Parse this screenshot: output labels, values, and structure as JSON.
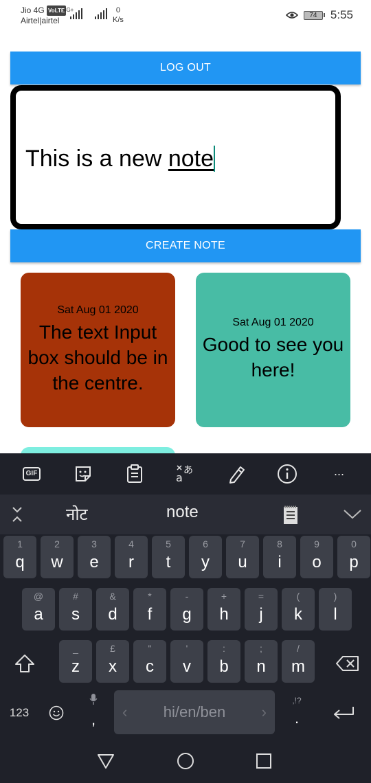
{
  "status_bar": {
    "carrier_line1": "Jio 4G",
    "volte_badge": "VoLTE",
    "carrier_line2": "Airtel|airtel",
    "network_type": "4G+",
    "speed_value": "0",
    "speed_unit": "K/s",
    "battery_level": "74",
    "time": "5:55"
  },
  "app": {
    "logout_label": "LOG OUT",
    "note_text_plain": "This is a new ",
    "note_text_word": "note",
    "create_label": "CREATE NOTE",
    "notes": [
      {
        "date": "Sat Aug 01 2020",
        "text": "The text Input box should be in the centre.",
        "color": "#a63308"
      },
      {
        "date": "Sat Aug 01 2020",
        "text": "Good to see you here!",
        "color": "#48bca5"
      }
    ],
    "partial_card_color": "#7eeee0"
  },
  "keyboard": {
    "toolbar_icons": [
      "gif-icon",
      "sticker-icon",
      "clipboard-icon",
      "translate-icon",
      "edit-icon",
      "info-icon",
      "more-icon"
    ],
    "gif_label": "GIF",
    "more_label": "···",
    "suggestions": [
      "नोट",
      "note"
    ],
    "row1": [
      {
        "hint": "1",
        "key": "q"
      },
      {
        "hint": "2",
        "key": "w"
      },
      {
        "hint": "3",
        "key": "e"
      },
      {
        "hint": "4",
        "key": "r"
      },
      {
        "hint": "5",
        "key": "t"
      },
      {
        "hint": "6",
        "key": "y"
      },
      {
        "hint": "7",
        "key": "u"
      },
      {
        "hint": "8",
        "key": "i"
      },
      {
        "hint": "9",
        "key": "o"
      },
      {
        "hint": "0",
        "key": "p"
      }
    ],
    "row2": [
      {
        "hint": "@",
        "key": "a"
      },
      {
        "hint": "#",
        "key": "s"
      },
      {
        "hint": "&",
        "key": "d"
      },
      {
        "hint": "*",
        "key": "f"
      },
      {
        "hint": "-",
        "key": "g"
      },
      {
        "hint": "+",
        "key": "h"
      },
      {
        "hint": "=",
        "key": "j"
      },
      {
        "hint": "(",
        "key": "k"
      },
      {
        "hint": ")",
        "key": "l"
      }
    ],
    "row3": [
      {
        "hint": "_",
        "key": "z"
      },
      {
        "hint": "£",
        "key": "x"
      },
      {
        "hint": "\"",
        "key": "c"
      },
      {
        "hint": "'",
        "key": "v"
      },
      {
        "hint": ":",
        "key": "b"
      },
      {
        "hint": ";",
        "key": "n"
      },
      {
        "hint": "/",
        "key": "m"
      }
    ],
    "numbers_label": "123",
    "comma_label": ",",
    "space_label": "hi/en/ben",
    "period_hint": ",!?",
    "period_label": "."
  }
}
